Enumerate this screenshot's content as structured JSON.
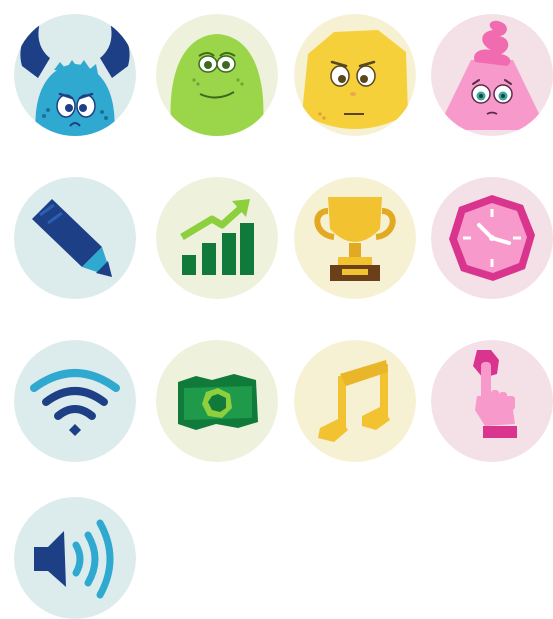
{
  "colors": {
    "bg_blue": "#dcebec",
    "bg_green": "#eef2dc",
    "bg_yellow": "#f7f1d4",
    "bg_pink": "#f4e1e7",
    "monster_blue": "#2fa9cf",
    "monster_green": "#9bd64a",
    "monster_yellow": "#f5d03b",
    "monster_pink": "#f79acb",
    "navy": "#1d3f86",
    "dark_green": "#0f7a3a",
    "gold": "#f2c230",
    "magenta": "#d9358f"
  },
  "icons": [
    {
      "name": "blue-horned-monster-avatar",
      "background": "blue"
    },
    {
      "name": "green-blob-monster-avatar",
      "background": "green"
    },
    {
      "name": "yellow-worried-monster-avatar",
      "background": "yellow"
    },
    {
      "name": "pink-swirl-monster-avatar",
      "background": "pink"
    },
    {
      "name": "pencil-icon",
      "background": "blue"
    },
    {
      "name": "growth-chart-icon",
      "background": "green"
    },
    {
      "name": "trophy-icon",
      "background": "yellow"
    },
    {
      "name": "clock-icon",
      "background": "pink"
    },
    {
      "name": "wifi-icon",
      "background": "blue"
    },
    {
      "name": "money-icon",
      "background": "green"
    },
    {
      "name": "music-note-icon",
      "background": "yellow"
    },
    {
      "name": "pointing-hand-icon",
      "background": "pink"
    },
    {
      "name": "speaker-volume-icon",
      "background": "blue"
    }
  ]
}
